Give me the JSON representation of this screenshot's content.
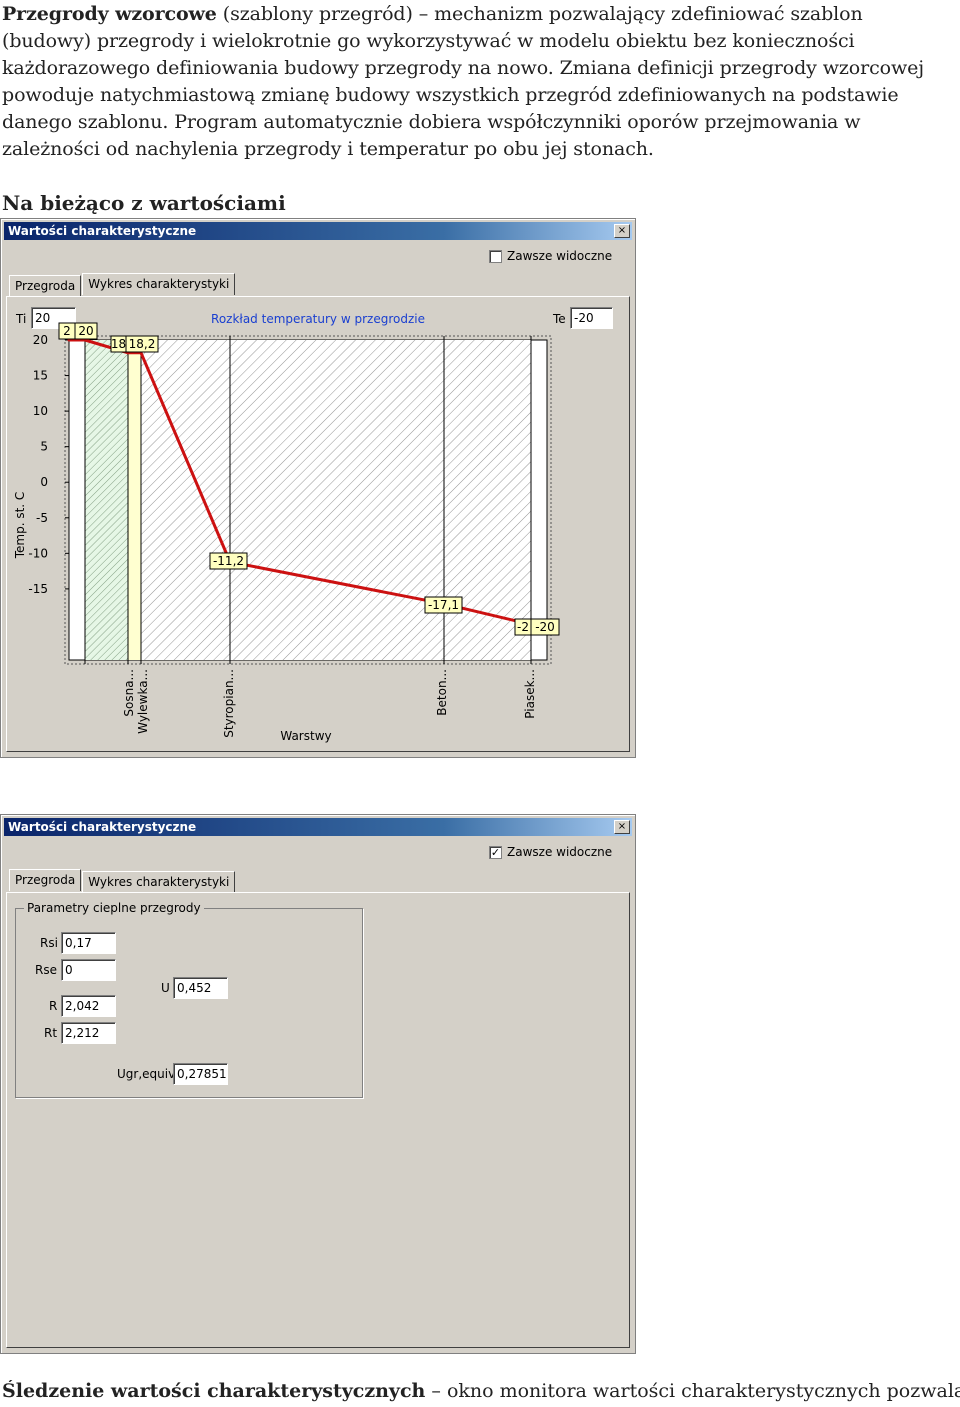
{
  "intro": {
    "term": "Przegrody wzorcowe",
    "body": " (szablony przegród) – mechanizm pozwalający zdefiniować szablon (budowy) przegrody i wielokrotnie go wykorzystywać w modelu obiektu bez konieczności każdorazowego definiowania budowy przegrody na nowo. Zmiana definicji przegrody wzorcowej powoduje natychmiastową zmianę budowy wszystkich przegród zdefiniowanych na podstawie danego szablonu. Program automatycznie dobiera współczynniki oporów przejmowania w zależności od nachylenia przegrody i temperatur po obu jej stonach."
  },
  "heading": "Na bieżąco z wartościami",
  "window1": {
    "title": "Wartości charakterystyczne",
    "close": "×",
    "always_visible": "Zawsze widoczne",
    "always_visible_checked": false,
    "tabs": [
      "Przegroda",
      "Wykres charakterystyki"
    ],
    "active_tab": 1,
    "ti_label": "Ti",
    "ti_value": "20",
    "te_label": "Te",
    "te_value": "-20"
  },
  "chart_data": {
    "type": "line",
    "title": "Rozkład temperatury w przegrodzie",
    "xlabel": "Warstwy",
    "ylabel": "Temp. st. C",
    "ylim": [
      -20,
      20
    ],
    "yticks": [
      "20",
      "15",
      "10",
      "5",
      "0",
      "-5",
      "-10",
      "-15"
    ],
    "layers": [
      "Sosna...",
      "Wylewka...",
      "Styropian...",
      "Beton...",
      "Piasek..."
    ],
    "points": [
      {
        "label": "20",
        "value": 20
      },
      {
        "label": "2",
        "value": 20
      },
      {
        "label": "18,2",
        "value": 18.2
      },
      {
        "label": "18",
        "value": 18.2
      },
      {
        "label": "-11,2",
        "value": -11.2
      },
      {
        "label": "-17,1",
        "value": -17.1
      },
      {
        "label": "-2",
        "value": -20
      },
      {
        "label": "-20",
        "value": -20
      }
    ],
    "colors": {
      "line": "#cc1111",
      "title": "#1a3fd0",
      "label_bg": "#ffffc0"
    }
  },
  "window2": {
    "title": "Wartości charakterystyczne",
    "close": "×",
    "always_visible": "Zawsze widoczne",
    "always_visible_checked": true,
    "check_mark": "✓",
    "tabs": [
      "Przegroda",
      "Wykres charakterystyki"
    ],
    "active_tab": 0,
    "group_title": "Parametry cieplne przegrody",
    "fields": [
      {
        "label": "Rsi",
        "value": "0,17"
      },
      {
        "label": "Rse",
        "value": "0"
      },
      {
        "label": "R",
        "value": "2,042"
      },
      {
        "label": "Rt",
        "value": "2,212"
      },
      {
        "label": "U",
        "value": "0,452"
      },
      {
        "label": "Ugr,equiv",
        "value": "0,27851"
      }
    ]
  },
  "footer": {
    "term": "Śledzenie wartości charakterystycznych",
    "body": " – okno monitora wartości charakterystycznych pozwala"
  }
}
